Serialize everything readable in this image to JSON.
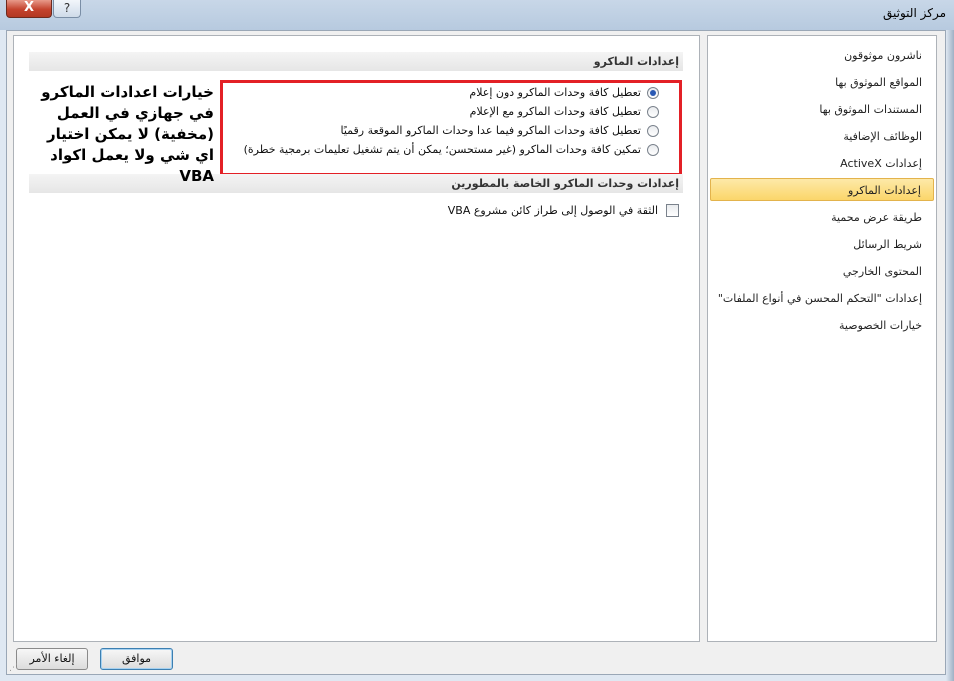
{
  "window": {
    "title": "مركز التوثيق",
    "close_label": "X",
    "help_label": "?"
  },
  "nav": {
    "items": [
      {
        "label": "ناشرون موثوقون"
      },
      {
        "label": "المواقع الموثوق بها"
      },
      {
        "label": "المستندات الموثوق بها"
      },
      {
        "label": "الوظائف الإضافية"
      },
      {
        "label": "إعدادات ActiveX"
      },
      {
        "label": "إعدادات الماكرو"
      },
      {
        "label": "طريقة عرض محمية"
      },
      {
        "label": "شريط الرسائل"
      },
      {
        "label": "المحتوى الخارجي"
      },
      {
        "label": "إعدادات \"التحكم المحسن في أنواع الملفات\""
      },
      {
        "label": "خيارات الخصوصية"
      }
    ],
    "selected_index": 5
  },
  "macro_settings": {
    "heading": "إعدادات الماكرو",
    "options": [
      {
        "label": "تعطيل كافة وحدات الماكرو دون إعلام",
        "selected": true
      },
      {
        "label": "تعطيل كافة وحدات الماكرو مع الإعلام",
        "selected": false
      },
      {
        "label": "تعطيل كافة وحدات الماكرو فيما عدا وحدات الماكرو الموقعة رقميًا",
        "selected": false
      },
      {
        "label": "تمكين كافة وحدات الماكرو (غير مستحسن؛ يمكن أن يتم تشغيل تعليمات برمجية خطرة)",
        "selected": false
      }
    ]
  },
  "developer_settings": {
    "heading": "إعدادات وحدات الماكرو الخاصة بالمطورين",
    "trust_vba_label": "الثقة في الوصول إلى طراز كائن مشروع VBA",
    "trust_vba_checked": false
  },
  "annotation": {
    "text": "خيارات اعدادات الماكرو في جهازي في العمل (مخفية) لا يمكن اختيار اي شي ولا يعمل اكواد VBA",
    "box_color": "#e32026"
  },
  "buttons": {
    "ok_label": "موافق",
    "cancel_label": "إلغاء الأمر"
  }
}
